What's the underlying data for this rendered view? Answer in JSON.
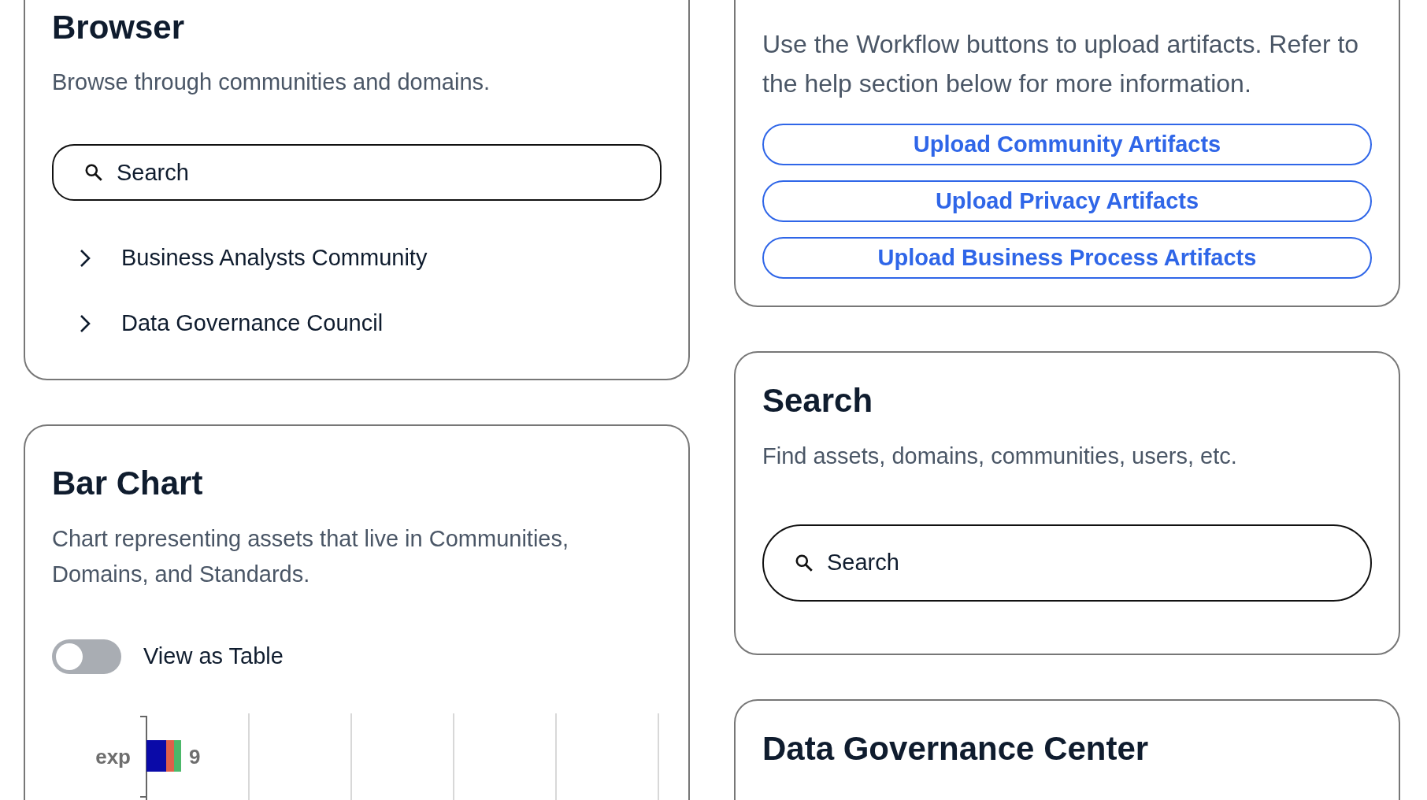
{
  "browser": {
    "title": "Browser",
    "description": "Browse through communities and domains.",
    "search": {
      "placeholder": "Search"
    },
    "items": [
      {
        "label": "Business Analysts Community",
        "expanded": false
      },
      {
        "label": "Data Governance Council",
        "expanded": false
      }
    ]
  },
  "bar_chart_card": {
    "title": "Bar Chart",
    "description": "Chart representing assets that live in Communities, Domains, and Standards.",
    "toggle": {
      "label": "View as Table",
      "checked": false
    },
    "chart": {
      "category": "exp",
      "value_label": "9"
    }
  },
  "workflow": {
    "description": "Use the Workflow buttons to upload artifacts. Refer to the help section below for more information.",
    "buttons": [
      "Upload Community Artifacts",
      "Upload Privacy Artifacts",
      "Upload Business Process Artifacts"
    ]
  },
  "search_card": {
    "title": "Search",
    "description": "Find assets, domains, communities, users, etc.",
    "search": {
      "placeholder": "Search"
    }
  },
  "data_governance_center": {
    "title": "Data Governance Center"
  }
}
